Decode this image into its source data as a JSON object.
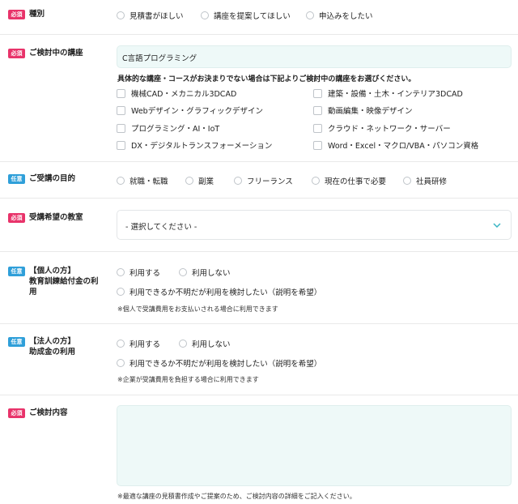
{
  "type_section": {
    "badge": "必須",
    "label": "種別",
    "options": [
      "見積書がほしい",
      "講座を提案してほしい",
      "申込みをしたい"
    ]
  },
  "course_section": {
    "badge": "必須",
    "label": "ご検討中の講座",
    "input_value": "C言語プログラミング",
    "hint": "具体的な講座・コースがお決まりでない場合は下記よりご検討中の講座をお選びください。",
    "checkboxes": [
      "機械CAD・メカニカル3DCAD",
      "建築・設備・土木・インテリア3DCAD",
      "Webデザイン・グラフィックデザイン",
      "動画編集・映像デザイン",
      "プログラミング・AI・IoT",
      "クラウド・ネットワーク・サーバー",
      "DX・デジタルトランスフォーメーション",
      "Word・Excel・マクロ/VBA・パソコン資格"
    ]
  },
  "purpose_section": {
    "badge": "任意",
    "label": "ご受講の目的",
    "options": [
      "就職・転職",
      "副業",
      "フリーランス",
      "現在の仕事で必要",
      "社員研修"
    ]
  },
  "classroom_section": {
    "badge": "必須",
    "label": "受講希望の教室",
    "select_value": "- 選択してください -"
  },
  "individual_section": {
    "badge": "任意",
    "label_line1": "【個人の方】",
    "label_line2": "教育訓練給付金の利",
    "label_line3": "用",
    "options": [
      "利用する",
      "利用しない",
      "利用できるか不明だが利用を検討したい（説明を希望）"
    ],
    "note": "※個人で受講費用をお支払いされる場合に利用できます"
  },
  "corporate_section": {
    "badge": "任意",
    "label_line1": "【法人の方】",
    "label_line2": "助成金の利用",
    "options": [
      "利用する",
      "利用しない",
      "利用できるか不明だが利用を検討したい（説明を希望）"
    ],
    "note": "※企業が受講費用を負担する場合に利用できます"
  },
  "details_section": {
    "badge": "必須",
    "label": "ご検討内容",
    "textarea_value": "",
    "note": "※最適な講座の見積書作成やご提案のため、ご検討内容の詳細をご記入ください。"
  },
  "colors": {
    "required_badge": "#e8336a",
    "optional_badge": "#2f9fd9",
    "field_bg": "#eef9f8",
    "chevron": "#3bb6c4"
  }
}
